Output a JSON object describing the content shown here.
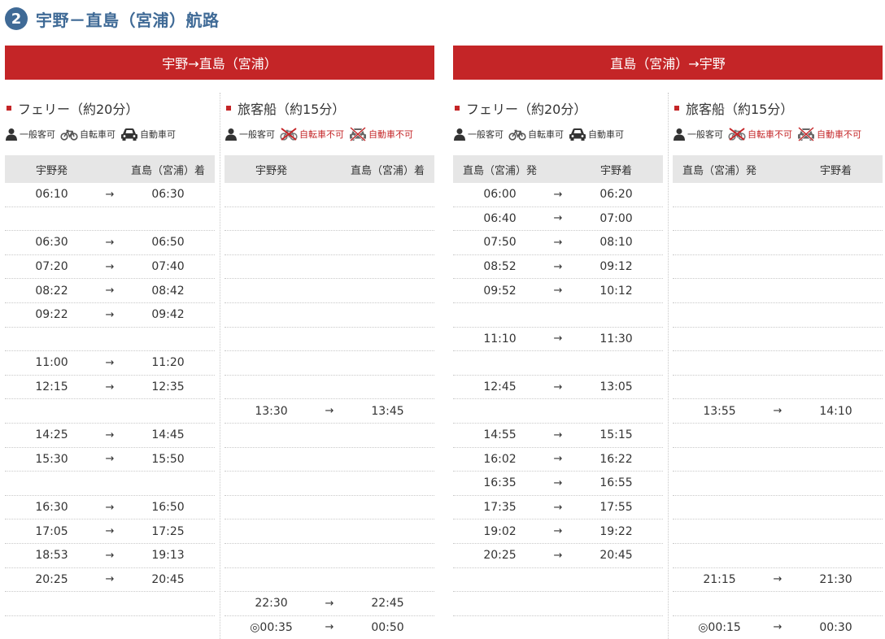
{
  "header": {
    "route_number": "2",
    "title": "宇野－直島（宮浦）航路"
  },
  "directions": {
    "outbound": "宇野→直島（宮浦）",
    "inbound": "直島（宮浦）→宇野"
  },
  "labels": {
    "passenger": "一般客可",
    "bicycle_ok": "自転車可",
    "car_ok": "自動車可",
    "bicycle_ng": "自転車不可",
    "car_ng": "自動車不可"
  },
  "arrow_glyph": "→",
  "colors": {
    "accent_red": "#c42527",
    "title_blue": "#3f6a96",
    "table_header_bg": "#e6e6e6"
  },
  "columns": [
    {
      "title": "フェリー（約20分）",
      "bicycle_allowed": true,
      "car_allowed": true,
      "header_dep": "宇野発",
      "header_arr": "直島（宮浦）着",
      "rows": [
        [
          "06:10",
          "06:30"
        ],
        [
          "",
          ""
        ],
        [
          "06:30",
          "06:50"
        ],
        [
          "07:20",
          "07:40"
        ],
        [
          "08:22",
          "08:42"
        ],
        [
          "09:22",
          "09:42"
        ],
        [
          "",
          ""
        ],
        [
          "11:00",
          "11:20"
        ],
        [
          "12:15",
          "12:35"
        ],
        [
          "",
          ""
        ],
        [
          "14:25",
          "14:45"
        ],
        [
          "15:30",
          "15:50"
        ],
        [
          "",
          ""
        ],
        [
          "16:30",
          "16:50"
        ],
        [
          "17:05",
          "17:25"
        ],
        [
          "18:53",
          "19:13"
        ],
        [
          "20:25",
          "20:45"
        ],
        [
          "",
          ""
        ],
        [
          "",
          ""
        ]
      ]
    },
    {
      "title": "旅客船（約15分）",
      "bicycle_allowed": false,
      "car_allowed": false,
      "header_dep": "宇野発",
      "header_arr": "直島（宮浦）着",
      "rows": [
        [
          "",
          ""
        ],
        [
          "",
          ""
        ],
        [
          "",
          ""
        ],
        [
          "",
          ""
        ],
        [
          "",
          ""
        ],
        [
          "",
          ""
        ],
        [
          "",
          ""
        ],
        [
          "",
          ""
        ],
        [
          "",
          ""
        ],
        [
          "13:30",
          "13:45"
        ],
        [
          "",
          ""
        ],
        [
          "",
          ""
        ],
        [
          "",
          ""
        ],
        [
          "",
          ""
        ],
        [
          "",
          ""
        ],
        [
          "",
          ""
        ],
        [
          "",
          ""
        ],
        [
          "22:30",
          "22:45"
        ],
        [
          "◎00:35",
          "00:50"
        ]
      ]
    },
    {
      "title": "フェリー（約20分）",
      "bicycle_allowed": true,
      "car_allowed": true,
      "header_dep": "直島（宮浦）発",
      "header_arr": "宇野着",
      "rows": [
        [
          "06:00",
          "06:20"
        ],
        [
          "06:40",
          "07:00"
        ],
        [
          "07:50",
          "08:10"
        ],
        [
          "08:52",
          "09:12"
        ],
        [
          "09:52",
          "10:12"
        ],
        [
          "",
          ""
        ],
        [
          "11:10",
          "11:30"
        ],
        [
          "",
          ""
        ],
        [
          "12:45",
          "13:05"
        ],
        [
          "",
          ""
        ],
        [
          "14:55",
          "15:15"
        ],
        [
          "16:02",
          "16:22"
        ],
        [
          "16:35",
          "16:55"
        ],
        [
          "17:35",
          "17:55"
        ],
        [
          "19:02",
          "19:22"
        ],
        [
          "20:25",
          "20:45"
        ],
        [
          "",
          ""
        ],
        [
          "",
          ""
        ],
        [
          "",
          ""
        ]
      ]
    },
    {
      "title": "旅客船（約15分）",
      "bicycle_allowed": false,
      "car_allowed": false,
      "header_dep": "直島（宮浦）発",
      "header_arr": "宇野着",
      "rows": [
        [
          "",
          ""
        ],
        [
          "",
          ""
        ],
        [
          "",
          ""
        ],
        [
          "",
          ""
        ],
        [
          "",
          ""
        ],
        [
          "",
          ""
        ],
        [
          "",
          ""
        ],
        [
          "",
          ""
        ],
        [
          "",
          ""
        ],
        [
          "13:55",
          "14:10"
        ],
        [
          "",
          ""
        ],
        [
          "",
          ""
        ],
        [
          "",
          ""
        ],
        [
          "",
          ""
        ],
        [
          "",
          ""
        ],
        [
          "",
          ""
        ],
        [
          "21:15",
          "21:30"
        ],
        [
          "",
          ""
        ],
        [
          "◎00:15",
          "00:30"
        ]
      ]
    }
  ]
}
